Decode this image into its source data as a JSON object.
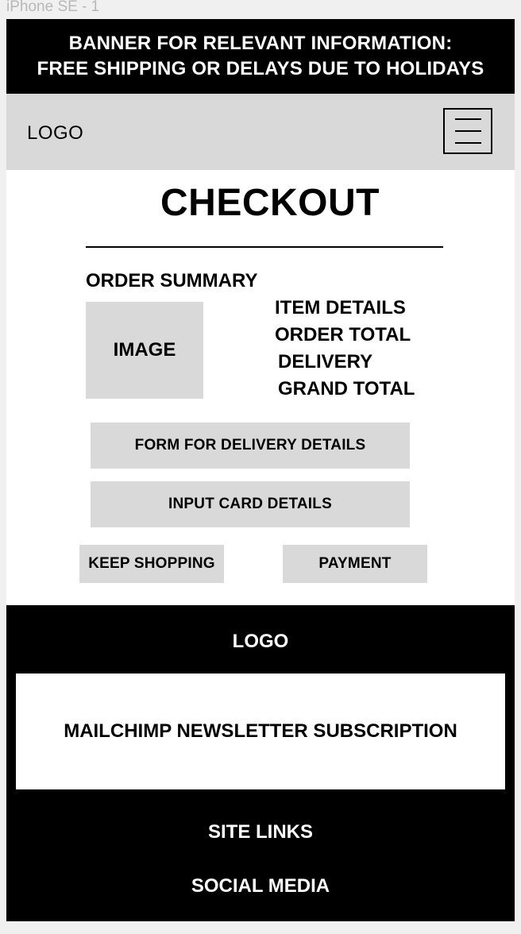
{
  "frame_label": "iPhone SE - 1",
  "banner": {
    "line1": "BANNER FOR RELEVANT INFORMATION:",
    "line2": "FREE SHIPPING OR DELAYS DUE TO HOLIDAYS"
  },
  "header": {
    "logo": "LOGO"
  },
  "main": {
    "title": "CHECKOUT",
    "summary_label": "ORDER SUMMARY",
    "image_placeholder": "IMAGE",
    "details": {
      "item": "ITEM DETAILS",
      "order_total": "ORDER TOTAL",
      "delivery": "DELIVERY",
      "grand_total": "GRAND TOTAL"
    },
    "delivery_form_label": "FORM FOR DELIVERY DETAILS",
    "card_input_label": "INPUT CARD DETAILS",
    "keep_shopping_label": "KEEP SHOPPING",
    "payment_label": "PAYMENT"
  },
  "footer": {
    "logo": "LOGO",
    "newsletter": "MAILCHIMP NEWSLETTER SUBSCRIPTION",
    "site_links": "SITE LINKS",
    "social_media": "SOCIAL MEDIA"
  },
  "colors": {
    "banner_bg": "#000000",
    "header_bg": "#d9d9d9",
    "placeholder_gray": "#d9d9d9",
    "footer_bg": "#000000"
  },
  "icons": {
    "menu": "hamburger-menu-icon"
  }
}
